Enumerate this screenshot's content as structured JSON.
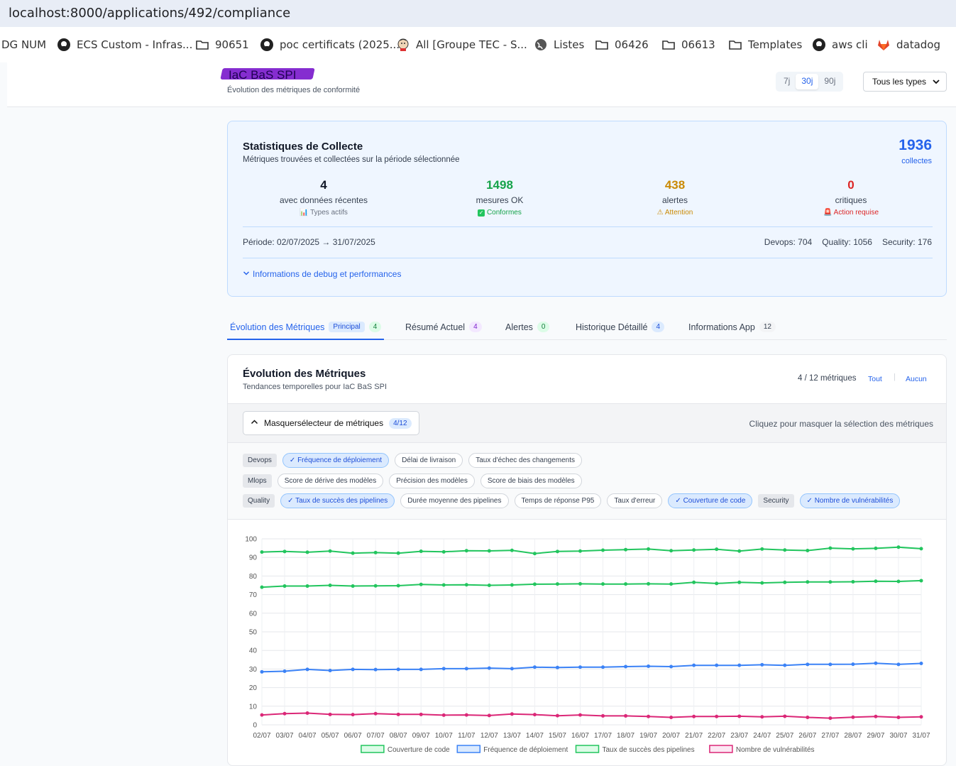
{
  "browser": {
    "url": "localhost:8000/applications/492/compliance",
    "bookmarks": [
      {
        "label": "DG NUM",
        "icon": "none"
      },
      {
        "label": "ECS Custom - Infras...",
        "icon": "github-icon"
      },
      {
        "label": "90651",
        "icon": "folder-icon"
      },
      {
        "label": "poc certificats (2025...",
        "icon": "github-icon"
      },
      {
        "label": "All [Groupe TEC - S...",
        "icon": "jenkins-icon"
      },
      {
        "label": "Listes",
        "icon": "globe-icon"
      },
      {
        "label": "06426",
        "icon": "folder-icon"
      },
      {
        "label": "06613",
        "icon": "folder-icon"
      },
      {
        "label": "Templates",
        "icon": "folder-icon"
      },
      {
        "label": "aws cli",
        "icon": "github-icon"
      },
      {
        "label": "datadog",
        "icon": "gitlab-icon"
      }
    ]
  },
  "header": {
    "app_name": "IaC BaS SPI",
    "subtitle": "Évolution des métriques de conformité",
    "periods": [
      "7j",
      "30j",
      "90j"
    ],
    "active_period": "30j",
    "type_filter": "Tous les types"
  },
  "stats": {
    "title": "Statistiques de Collecte",
    "subtitle": "Métriques trouvées et collectées sur la période sélectionnée",
    "total": "1936",
    "total_label": "collectes",
    "items": [
      {
        "value": "4",
        "label": "avec données récentes",
        "badge": "Types actifs",
        "color": "#111827",
        "badge_color": "#6b7280",
        "icon": "chart-icon"
      },
      {
        "value": "1498",
        "label": "mesures OK",
        "badge": "Conformes",
        "color": "#16a34a",
        "badge_color": "#16a34a",
        "icon": "check-icon"
      },
      {
        "value": "438",
        "label": "alertes",
        "badge": "Attention",
        "color": "#ca8a04",
        "badge_color": "#ca8a04",
        "icon": "warning-icon"
      },
      {
        "value": "0",
        "label": "critiques",
        "badge": "Action requise",
        "color": "#dc2626",
        "badge_color": "#dc2626",
        "icon": "alarm-icon"
      }
    ],
    "period_text": "Période: 02/07/2025 → 31/07/2025",
    "counts": [
      {
        "label": "Devops:",
        "value": "704"
      },
      {
        "label": "Quality:",
        "value": "1056"
      },
      {
        "label": "Security:",
        "value": "176"
      }
    ],
    "debug_label": "Informations de debug et performances"
  },
  "tabs": [
    {
      "label": "Évolution des Métriques",
      "extra": "Principal",
      "count": "4",
      "badge_bg": "#dcfce7",
      "badge_fg": "#15803d"
    },
    {
      "label": "Résumé Actuel",
      "count": "4",
      "badge_bg": "#f3e8ff",
      "badge_fg": "#7e22ce"
    },
    {
      "label": "Alertes",
      "count": "0",
      "badge_bg": "#dcfce7",
      "badge_fg": "#15803d"
    },
    {
      "label": "Historique Détaillé",
      "count": "4",
      "badge_bg": "#dbeafe",
      "badge_fg": "#1d4ed8"
    },
    {
      "label": "Informations App",
      "count": "12",
      "badge_bg": "#f3f4f6",
      "badge_fg": "#374151"
    }
  ],
  "evolution": {
    "title": "Évolution des Métriques",
    "subtitle": "Tendances temporelles pour IaC BaS SPI",
    "metric_count": "4 / 12 métriques",
    "all_label": "Tout",
    "none_label": "Aucun",
    "hide_label": "Masquersélecteur de métriques",
    "hide_count": "4/12",
    "hint": "Cliquez pour masquer la sélection des métriques",
    "rows": [
      [
        {
          "kind": "cat",
          "label": "Devops"
        },
        {
          "kind": "chip",
          "label": "Fréquence de déploiement",
          "on": true
        },
        {
          "kind": "chip",
          "label": "Délai de livraison",
          "on": false
        },
        {
          "kind": "chip",
          "label": "Taux d'échec des changements",
          "on": false
        }
      ],
      [
        {
          "kind": "cat",
          "label": "Mlops"
        },
        {
          "kind": "chip",
          "label": "Score de dérive des modèles",
          "on": false
        },
        {
          "kind": "chip",
          "label": "Précision des modèles",
          "on": false
        },
        {
          "kind": "chip",
          "label": "Score de biais des modèles",
          "on": false
        }
      ],
      [
        {
          "kind": "cat",
          "label": "Quality"
        },
        {
          "kind": "chip",
          "label": "Taux de succès des pipelines",
          "on": true
        },
        {
          "kind": "chip",
          "label": "Durée moyenne des pipelines",
          "on": false
        },
        {
          "kind": "chip",
          "label": "Temps de réponse P95",
          "on": false
        },
        {
          "kind": "chip",
          "label": "Taux d'erreur",
          "on": false
        },
        {
          "kind": "chip",
          "label": "Couverture de code",
          "on": true
        },
        {
          "kind": "cat",
          "label": "Security"
        },
        {
          "kind": "chip",
          "label": "Nombre de vulnérabilités",
          "on": true
        }
      ]
    ]
  },
  "chart_data": {
    "type": "line",
    "x": [
      "02/07",
      "03/07",
      "04/07",
      "05/07",
      "06/07",
      "07/07",
      "08/07",
      "09/07",
      "10/07",
      "11/07",
      "12/07",
      "13/07",
      "14/07",
      "15/07",
      "16/07",
      "17/07",
      "18/07",
      "19/07",
      "20/07",
      "21/07",
      "22/07",
      "23/07",
      "24/07",
      "25/07",
      "26/07",
      "27/07",
      "28/07",
      "29/07",
      "30/07",
      "31/07"
    ],
    "ylim": [
      0,
      100
    ],
    "yticks": [
      0,
      10,
      20,
      30,
      40,
      50,
      60,
      70,
      80,
      90,
      100
    ],
    "grid": true,
    "legend_position": "bottom",
    "series": [
      {
        "name": "Couverture de code",
        "color": "#22c55e",
        "fill": "#dcfce7",
        "values": [
          74.0,
          74.6,
          74.6,
          75.0,
          74.6,
          74.7,
          74.8,
          75.5,
          75.2,
          75.3,
          75.0,
          75.2,
          75.6,
          75.7,
          75.8,
          75.7,
          75.7,
          75.8,
          75.7,
          76.6,
          76.0,
          76.6,
          76.3,
          76.6,
          76.8,
          76.8,
          76.9,
          77.2,
          77.1,
          77.5
        ]
      },
      {
        "name": "Fréquence de déploiement",
        "color": "#3b82f6",
        "fill": "#dbeafe",
        "values": [
          28.5,
          28.8,
          29.8,
          29.2,
          29.8,
          29.7,
          29.8,
          29.8,
          30.2,
          30.2,
          30.5,
          30.2,
          31.0,
          30.8,
          31.0,
          31.0,
          31.3,
          31.5,
          31.3,
          32.0,
          32.0,
          32.0,
          32.3,
          32.0,
          32.5,
          32.5,
          32.6,
          33.1,
          32.5,
          33.0
        ]
      },
      {
        "name": "Taux de succès des pipelines",
        "color": "#22c55e",
        "fill": "#dcfce7",
        "values": [
          92.9,
          93.2,
          92.8,
          93.4,
          92.3,
          92.6,
          92.3,
          93.3,
          93.0,
          93.6,
          93.5,
          93.8,
          92.1,
          93.2,
          93.4,
          93.9,
          94.2,
          94.5,
          93.6,
          94.0,
          94.4,
          93.4,
          94.5,
          94.0,
          93.7,
          95.0,
          94.6,
          94.9,
          95.5,
          94.7
        ]
      },
      {
        "name": "Nombre de vulnérabilités",
        "color": "#db2777",
        "fill": "#fce7f3",
        "values": [
          5.3,
          6.0,
          6.3,
          5.6,
          5.5,
          6.0,
          5.6,
          5.6,
          5.2,
          5.3,
          5.0,
          5.8,
          5.5,
          4.9,
          5.3,
          4.8,
          4.8,
          4.5,
          4.0,
          4.5,
          4.5,
          4.6,
          4.3,
          4.6,
          4.0,
          3.6,
          4.1,
          4.5,
          4.0,
          4.3
        ]
      }
    ]
  }
}
